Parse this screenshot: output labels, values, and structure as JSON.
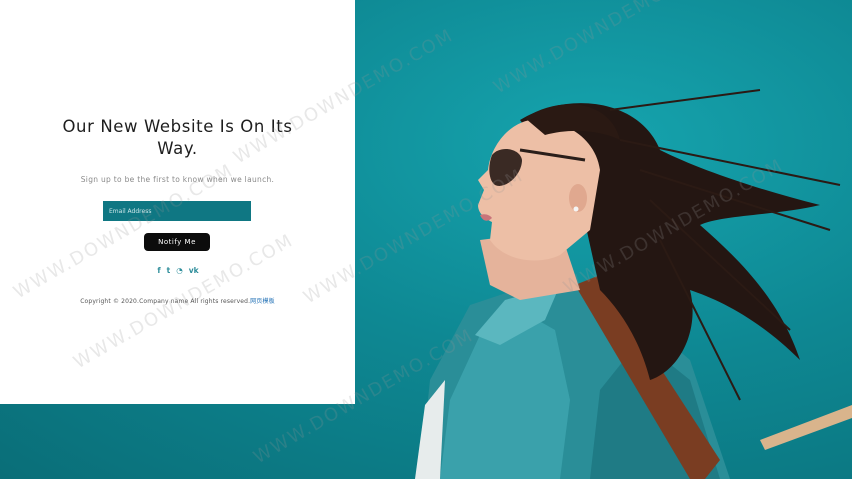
{
  "hero": {
    "headline": "Our New Website Is On Its Way.",
    "subtext": "Sign up to be the first to know when we launch.",
    "email_placeholder": "Email Address",
    "notify_label": "Notify Me"
  },
  "social": [
    {
      "icon": "facebook-icon",
      "glyph": "f"
    },
    {
      "icon": "twitter-icon",
      "glyph": "t"
    },
    {
      "icon": "rss-icon",
      "glyph": "◔"
    },
    {
      "icon": "vk-icon",
      "glyph": "vk"
    }
  ],
  "footer": {
    "copyright": "Copyright © 2020.Company name All rights reserved.",
    "link": "网页模板"
  },
  "watermark": "WWW.DOWNDEMO.COM",
  "colors": {
    "teal_field": "#0f7783",
    "teal_sky": "#0e8893",
    "button": "#0c0c0c",
    "social": "#2d8d9a"
  }
}
